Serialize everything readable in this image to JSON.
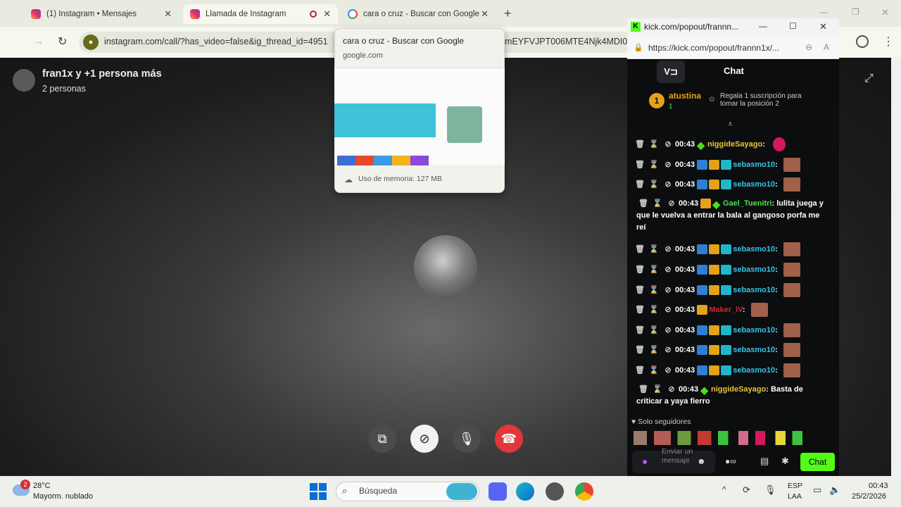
{
  "browser": {
    "tabs": [
      {
        "title": "(1) Instagram • Mensajes"
      },
      {
        "title": "Llamada de Instagram"
      },
      {
        "title": "cara o cruz - Buscar con Google"
      }
    ],
    "url": "instagram.com/call/?has_video=false&ig_thread_id=4951",
    "url_tail": "mEYFVJPT006MTE4Njk4MDI0"
  },
  "tab_preview": {
    "title": "cara o cruz - Buscar con Google",
    "domain": "google.com",
    "memory": "Uso de memoria: 127 MB"
  },
  "call": {
    "title": "fran1x y +1 persona más",
    "subtitle": "2 personas"
  },
  "kick": {
    "window_url": "kick.com/popout/frannn...",
    "page_url": "https://kick.com/popout/frannn1x/...",
    "chat_title": "Chat",
    "top_user": "atustina",
    "top_rank": "1",
    "top_count": "1",
    "gift_text": "Regala 1 suscripción para tomar la posición 2",
    "messages": [
      {
        "time": "00:43",
        "user": "niggideSayago",
        "color": "#e8c53a",
        "text": ""
      },
      {
        "time": "00:43",
        "user": "sebasmo10",
        "color": "#35c5e6",
        "text": ""
      },
      {
        "time": "00:43",
        "user": "sebasmo10",
        "color": "#35c5e6",
        "text": ""
      },
      {
        "time": "00:43",
        "user": "Gael_Tuenitri",
        "color": "#44e34a",
        "text": "lulita juega y que le vuelva a entrar la bala al gangoso porfa me reí"
      },
      {
        "time": "00:43",
        "user": "sebasmo10",
        "color": "#35c5e6",
        "text": ""
      },
      {
        "time": "00:43",
        "user": "sebasmo10",
        "color": "#35c5e6",
        "text": ""
      },
      {
        "time": "00:43",
        "user": "sebasmo10",
        "color": "#35c5e6",
        "text": ""
      },
      {
        "time": "00:43",
        "user": "Maker_IV",
        "color": "#d2262b",
        "text": ""
      },
      {
        "time": "00:43",
        "user": "sebasmo10",
        "color": "#35c5e6",
        "text": ""
      },
      {
        "time": "00:43",
        "user": "sebasmo10",
        "color": "#35c5e6",
        "text": ""
      },
      {
        "time": "00:43",
        "user": "sebasmo10",
        "color": "#35c5e6",
        "text": ""
      },
      {
        "time": "00:43",
        "user": "niggideSayago",
        "color": "#e8c53a",
        "text": "Basta de criticar a yaya fierro"
      }
    ],
    "followers_only": "Solo seguidores",
    "input_placeholder": "Enviar un mensaje",
    "send_label": "Chat"
  },
  "taskbar": {
    "weather_temp": "28°C",
    "weather_desc": "Mayorm. nublado",
    "weather_badge": "2",
    "search_placeholder": "Búsqueda",
    "lang1": "ESP",
    "lang2": "LAA",
    "time": "00:43",
    "date": "25/2/2026"
  }
}
